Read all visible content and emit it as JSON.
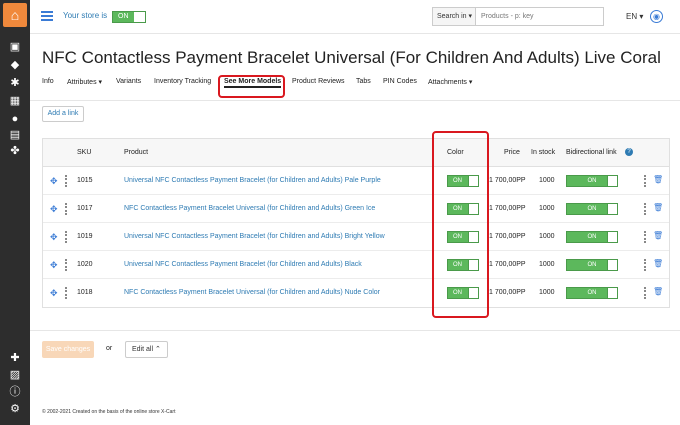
{
  "topbar": {
    "store_label": "Your store is",
    "store_toggle": "ON",
    "search_button": "Search in",
    "search_placeholder": "Products - p: key",
    "language": "EN"
  },
  "page": {
    "title": "NFC Contactless Payment Bracelet Universal (For Children And Adults) Live Coral"
  },
  "tabs": [
    {
      "label": "Info"
    },
    {
      "label": "Attributes"
    },
    {
      "label": "Variants"
    },
    {
      "label": "Inventory Tracking"
    },
    {
      "label": "See More Models"
    },
    {
      "label": "Product Reviews"
    },
    {
      "label": "Tabs"
    },
    {
      "label": "PIN Codes"
    },
    {
      "label": "Attachments"
    }
  ],
  "add_link_label": "Add a link",
  "table": {
    "headers": {
      "sku": "SKU",
      "product": "Product",
      "color": "Color",
      "price": "Price",
      "in_stock": "In stock",
      "bidirectional": "Bidirectional link"
    },
    "rows": [
      {
        "sku": "1015",
        "product": "Universal NFC Contactless Payment Bracelet (for Children and Adults) Pale Purple",
        "color": "ON",
        "price": "1 700,00PP",
        "stock": "1000",
        "bidirectional": "ON"
      },
      {
        "sku": "1017",
        "product": "NFC Contactless Payment Bracelet Universal (for Children and Adults) Green Ice",
        "color": "ON",
        "price": "1 700,00PP",
        "stock": "1000",
        "bidirectional": "ON"
      },
      {
        "sku": "1019",
        "product": "Universal NFC Contactless Payment Bracelet (for Children and Adults) Bright Yellow",
        "color": "ON",
        "price": "1 700,00PP",
        "stock": "1000",
        "bidirectional": "ON"
      },
      {
        "sku": "1020",
        "product": "Universal NFC Contactless Payment Bracelet (for Children and Adults) Black",
        "color": "ON",
        "price": "1 700,00PP",
        "stock": "1000",
        "bidirectional": "ON"
      },
      {
        "sku": "1018",
        "product": "NFC Contactless Payment Bracelet Universal (for Children and Adults) Nude Color",
        "color": "ON",
        "price": "1 700,00PP",
        "stock": "1000",
        "bidirectional": "ON"
      }
    ]
  },
  "footer": {
    "save_label": "Save changes",
    "or_label": "or",
    "edit_all_label": "Edit all",
    "copyright": "© 2002-2021 Created on the basis of the online store X-Cart"
  },
  "colors": {
    "accent": "#2e7bb3",
    "toggle_on": "#5cb85c",
    "highlight": "#d9181f",
    "logo": "#f0893c"
  }
}
